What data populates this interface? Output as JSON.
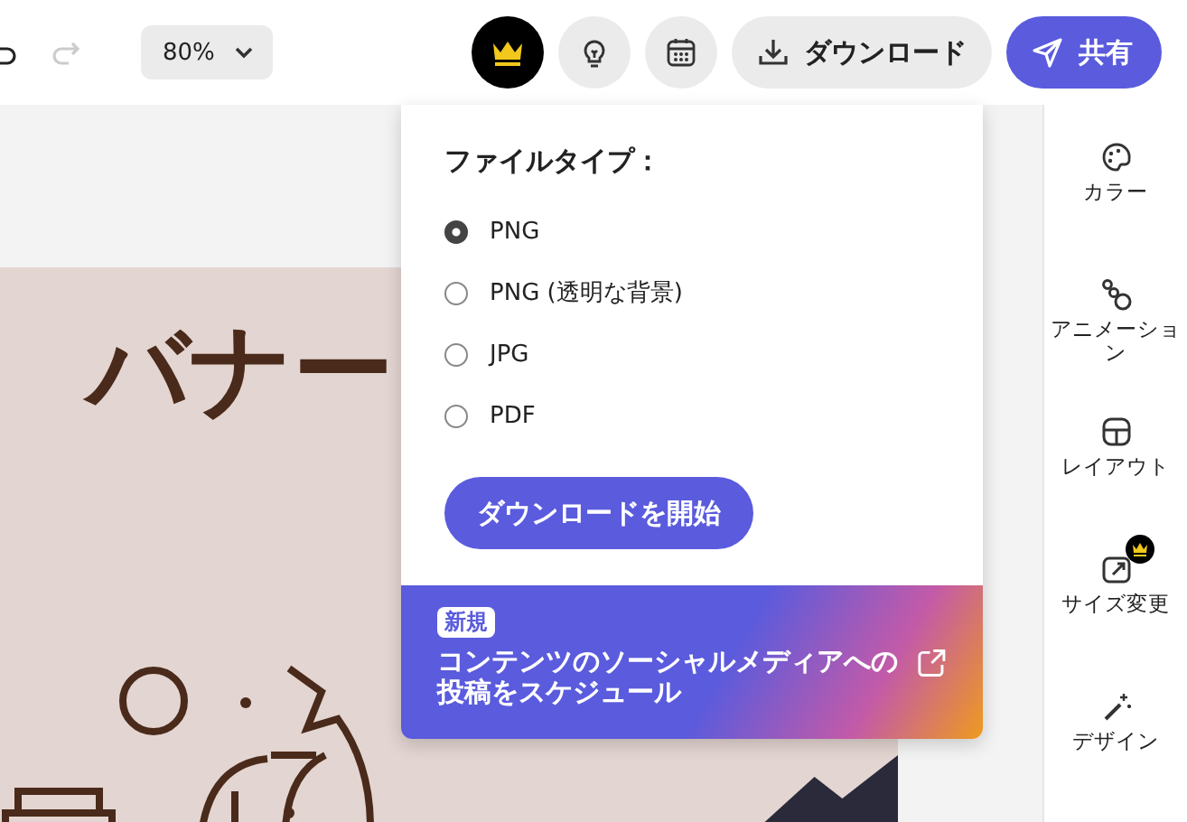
{
  "toolbar": {
    "zoom": "80%",
    "download_label": "ダウンロード",
    "share_label": "共有"
  },
  "canvas": {
    "title": "バナー"
  },
  "download_menu": {
    "heading": "ファイルタイプ：",
    "options": [
      {
        "label": "PNG",
        "selected": true
      },
      {
        "label": "PNG (透明な背景)",
        "selected": false
      },
      {
        "label": "JPG",
        "selected": false
      },
      {
        "label": "PDF",
        "selected": false
      }
    ],
    "start_button": "ダウンロードを開始",
    "promo": {
      "badge": "新規",
      "text": "コンテンツのソーシャルメディアへの投稿をスケジュール"
    }
  },
  "sidebar": {
    "items": [
      {
        "label": "カラー",
        "kind": "palette",
        "premium": false
      },
      {
        "label": "アニメーション",
        "kind": "animation",
        "premium": false
      },
      {
        "label": "レイアウト",
        "kind": "layout",
        "premium": false
      },
      {
        "label": "サイズ変更",
        "kind": "resize",
        "premium": true
      },
      {
        "label": "デザイン",
        "kind": "wand",
        "premium": false
      }
    ]
  }
}
